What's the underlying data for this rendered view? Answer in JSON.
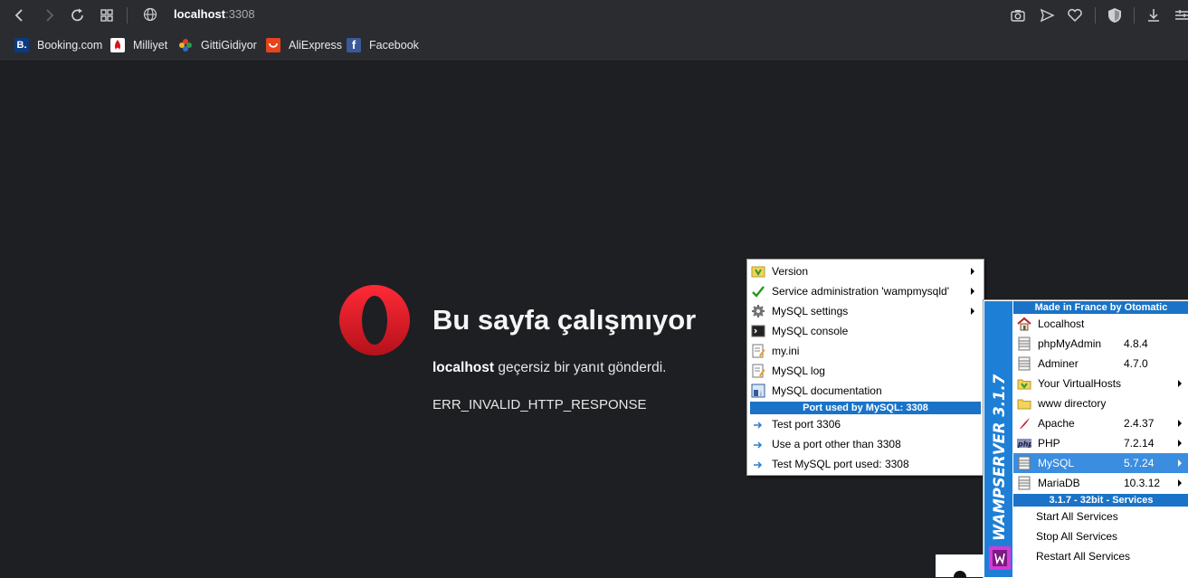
{
  "browser": {
    "url_host": "localhost",
    "url_port": ":3308",
    "bookmarks": [
      {
        "label": "Booking.com",
        "icon": "booking-icon",
        "color": "#0b3a80",
        "glyph": "B."
      },
      {
        "label": "Milliyet",
        "icon": "milliyet-icon",
        "color": "#ffffff",
        "glyph": ""
      },
      {
        "label": "GittiGidiyor",
        "icon": "gittigidiyor-icon",
        "color": "#2b2c30",
        "glyph": ""
      },
      {
        "label": "AliExpress",
        "icon": "aliexpress-icon",
        "color": "#e8431c",
        "glyph": ""
      },
      {
        "label": "Facebook",
        "icon": "facebook-icon",
        "color": "#3b5998",
        "glyph": "f"
      }
    ]
  },
  "error_page": {
    "title": "Bu sayfa çalışmıyor",
    "host": "localhost",
    "message": " geçersiz bir yanıt gönderdi.",
    "code": "ERR_INVALID_HTTP_RESPONSE"
  },
  "mysql_menu": {
    "items": [
      {
        "label": "Version",
        "icon": "version-icon",
        "submenu": true
      },
      {
        "label": "Service administration 'wampmysqld'",
        "icon": "check-icon",
        "submenu": true
      },
      {
        "label": "MySQL settings",
        "icon": "gear-icon",
        "submenu": true
      },
      {
        "label": "MySQL console",
        "icon": "console-icon",
        "submenu": false
      },
      {
        "label": "my.ini",
        "icon": "file-edit-icon",
        "submenu": false
      },
      {
        "label": "MySQL log",
        "icon": "log-icon",
        "submenu": false
      },
      {
        "label": "MySQL documentation",
        "icon": "doc-icon",
        "submenu": false
      }
    ],
    "port_header": "Port used by MySQL: 3308",
    "port_items": [
      {
        "label": "Test port 3306",
        "icon": "arrow-right-icon"
      },
      {
        "label": "Use a port other than 3308",
        "icon": "arrow-right-icon"
      },
      {
        "label": "Test MySQL port used: 3308",
        "icon": "arrow-right-icon"
      }
    ]
  },
  "wamp_menu": {
    "header": "Made in France by Otomatic",
    "items": [
      {
        "label": "Localhost",
        "version": "",
        "icon": "home-icon",
        "submenu": false,
        "selected": false
      },
      {
        "label": "phpMyAdmin",
        "version": "4.8.4",
        "icon": "database-icon",
        "submenu": false,
        "selected": false
      },
      {
        "label": "Adminer",
        "version": "4.7.0",
        "icon": "database-icon",
        "submenu": false,
        "selected": false
      },
      {
        "label": "Your VirtualHosts",
        "version": "",
        "icon": "folder-arrow-icon",
        "submenu": true,
        "selected": false
      },
      {
        "label": "www directory",
        "version": "",
        "icon": "folder-icon",
        "submenu": false,
        "selected": false
      },
      {
        "label": "Apache",
        "version": "2.4.37",
        "icon": "feather-icon",
        "submenu": true,
        "selected": false
      },
      {
        "label": "PHP",
        "version": "7.2.14",
        "icon": "php-icon",
        "submenu": true,
        "selected": false
      },
      {
        "label": "MySQL",
        "version": "5.7.24",
        "icon": "database-icon",
        "submenu": true,
        "selected": true
      },
      {
        "label": "MariaDB",
        "version": "10.3.12",
        "icon": "database-icon",
        "submenu": true,
        "selected": false
      }
    ],
    "services_header": "3.1.7 - 32bit - Services",
    "service_items": [
      {
        "label": "Start All Services"
      },
      {
        "label": "Stop All Services"
      },
      {
        "label": "Restart All Services"
      }
    ],
    "side_label": "WAMPSERVER 3.1.7"
  },
  "colors": {
    "page_bg": "#1e1f22",
    "chrome_bg": "#2b2c30",
    "menu_header": "#1a73c7",
    "menu_selected": "#3b8de0",
    "opera_red": "#e01f2c"
  }
}
